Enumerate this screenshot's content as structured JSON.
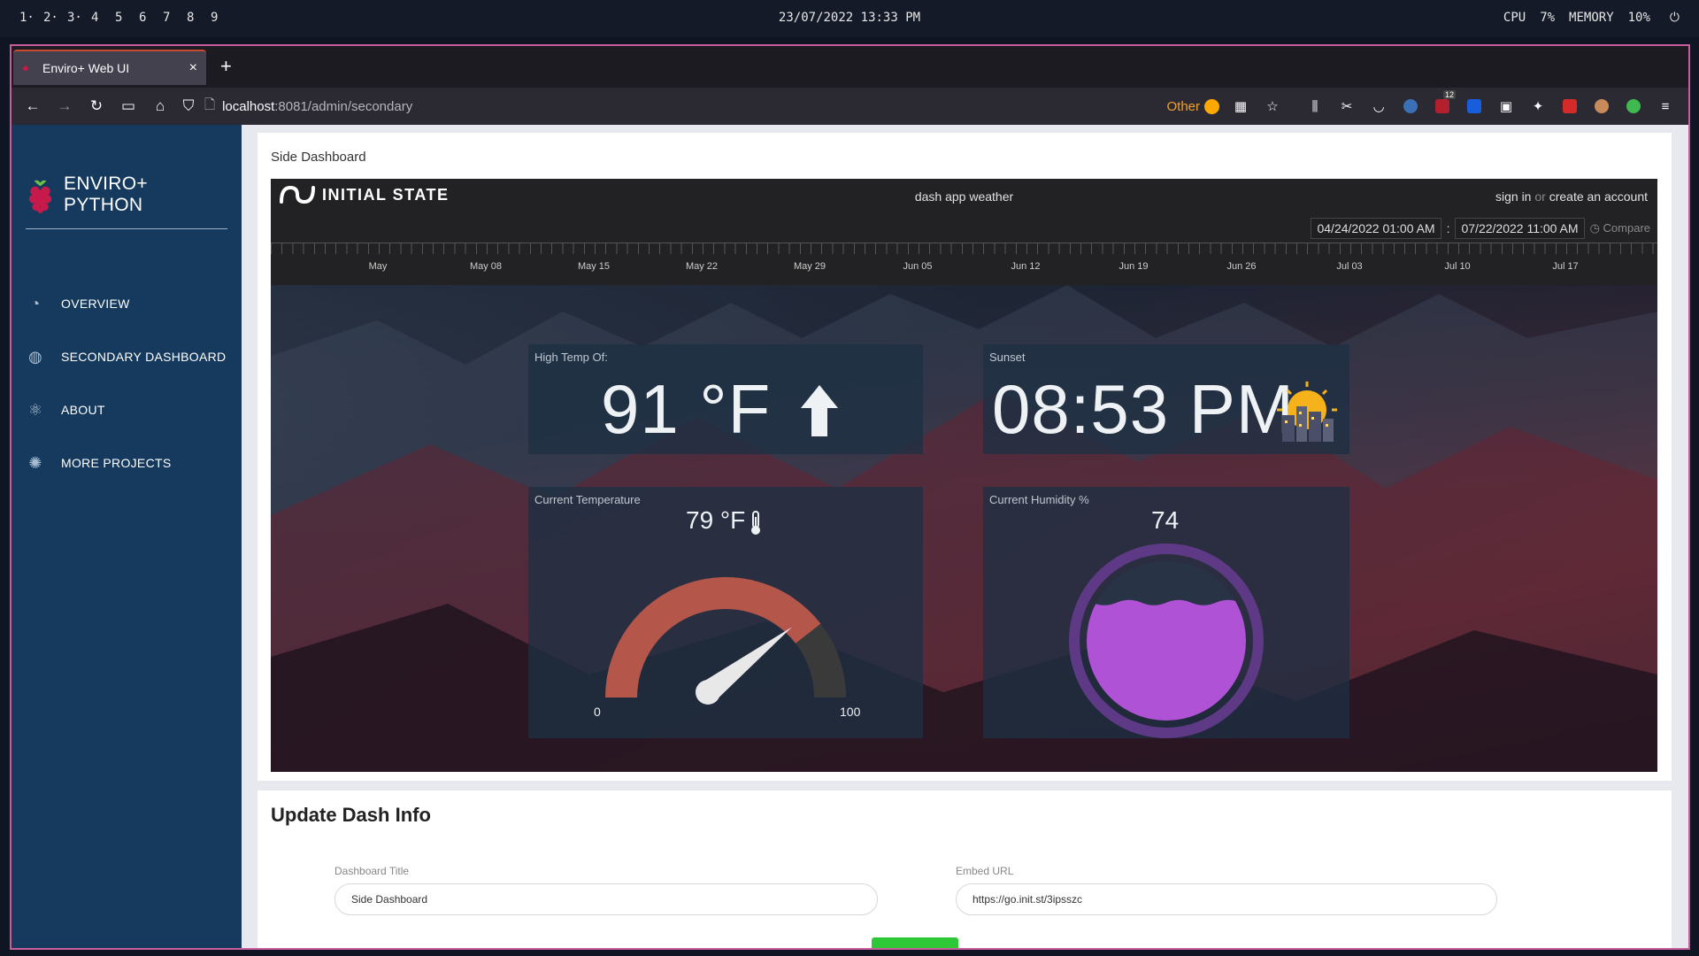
{
  "system_bar": {
    "workspaces": [
      "1·",
      "2·",
      "3·",
      "4",
      "5",
      "6",
      "7",
      "8",
      "9"
    ],
    "clock": "23/07/2022 13:33 PM",
    "cpu_label": "CPU",
    "cpu_value": "7%",
    "memory_label": "MEMORY",
    "memory_value": "10%"
  },
  "browser": {
    "tab_title": "Enviro+ Web UI",
    "url_host": "localhost",
    "url_path": ":8081/admin/secondary",
    "container_label": "Other",
    "extension_badge": "12"
  },
  "sidebar": {
    "brand": "ENVIRO+ PYTHON",
    "items": [
      {
        "label": "OVERVIEW",
        "icon": "pie-chart-icon"
      },
      {
        "label": "SECONDARY DASHBOARD",
        "icon": "globe-icon"
      },
      {
        "label": "ABOUT",
        "icon": "atom-icon"
      },
      {
        "label": "MORE PROJECTS",
        "icon": "lightbulb-icon"
      }
    ]
  },
  "dashboard_card": {
    "title": "Side Dashboard",
    "embed": {
      "brand": "INITIAL STATE",
      "dash_title": "dash app weather",
      "sign_in": "sign in",
      "or": "or",
      "create_account": "create an account",
      "date_from": "04/24/2022 01:00 AM",
      "date_sep": ":",
      "date_to": "07/22/2022 11:00 AM",
      "compare": "Compare",
      "timeline_labels": [
        "May",
        "May 08",
        "May 15",
        "May 22",
        "May 29",
        "Jun 05",
        "Jun 12",
        "Jun 19",
        "Jun 26",
        "Jul 03",
        "Jul 10",
        "Jul 17"
      ],
      "tiles": {
        "high_temp": {
          "label": "High Temp Of:",
          "value": "91 °F",
          "icon": "arrow-up-icon"
        },
        "sunset": {
          "label": "Sunset",
          "value": "08:53 PM",
          "icon": "sunset-city-icon"
        },
        "current_temp": {
          "label": "Current Temperature",
          "value": "79 °F",
          "icon": "thermometer-icon",
          "gauge_min": "0",
          "gauge_max": "100",
          "gauge_value": 79
        },
        "humidity": {
          "label": "Current Humidity %",
          "value": "74",
          "fill_fraction": 0.74
        }
      }
    }
  },
  "update_card": {
    "title": "Update Dash Info",
    "dashboard_title_label": "Dashboard Title",
    "dashboard_title_value": "Side Dashboard",
    "embed_url_label": "Embed URL",
    "embed_url_value": "https://go.init.st/3ipsszc"
  },
  "colors": {
    "sidebar": "#153a5e",
    "gauge_fill": "#b5564b",
    "gauge_track": "#3a3a3a",
    "humidity_fill": "#b052d6",
    "humidity_ring": "#5e3a86",
    "submit": "#2ec737",
    "window_border": "#c85d9c"
  }
}
